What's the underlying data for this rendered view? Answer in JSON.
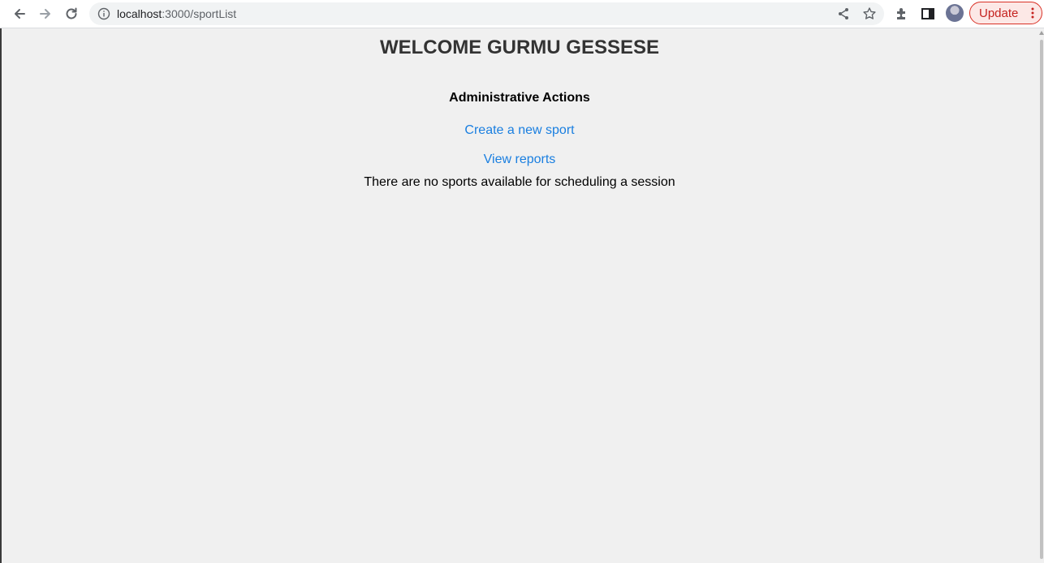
{
  "browser": {
    "url_host": "localhost",
    "url_path": ":3000/sportList",
    "update_label": "Update",
    "colors": {
      "update_accent": "#d93025",
      "link": "#1a7fe0"
    },
    "icons": [
      "back-arrow-icon",
      "forward-arrow-icon",
      "reload-icon",
      "info-icon",
      "share-icon",
      "star-icon",
      "extensions-icon",
      "side-panel-icon",
      "avatar",
      "more-vert-icon"
    ]
  },
  "page": {
    "welcome": "WELCOME GURMU GESSESE",
    "admin_title": "Administrative Actions",
    "create_link": "Create a new sport",
    "reports_link": "View reports",
    "empty_message": "There are no sports available for scheduling a session"
  }
}
